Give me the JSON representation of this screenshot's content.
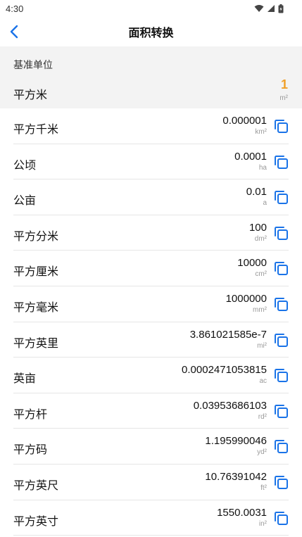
{
  "status_bar": {
    "time": "4:30"
  },
  "header": {
    "title": "面积转换"
  },
  "base": {
    "heading": "基准单位",
    "name": "平方米",
    "value": "1",
    "unit": "m²"
  },
  "units": [
    {
      "name": "平方千米",
      "value": "0.000001",
      "unit": "km²"
    },
    {
      "name": "公顷",
      "value": "0.0001",
      "unit": "ha"
    },
    {
      "name": "公亩",
      "value": "0.01",
      "unit": "a"
    },
    {
      "name": "平方分米",
      "value": "100",
      "unit": "dm²"
    },
    {
      "name": "平方厘米",
      "value": "10000",
      "unit": "cm²"
    },
    {
      "name": "平方毫米",
      "value": "1000000",
      "unit": "mm²"
    },
    {
      "name": "平方英里",
      "value": "3.861021585e-7",
      "unit": "mi²"
    },
    {
      "name": "英亩",
      "value": "0.0002471053815",
      "unit": "ac"
    },
    {
      "name": "平方杆",
      "value": "0.03953686103",
      "unit": "rd²"
    },
    {
      "name": "平方码",
      "value": "1.195990046",
      "unit": "yd²"
    },
    {
      "name": "平方英尺",
      "value": "10.76391042",
      "unit": "ft²"
    },
    {
      "name": "平方英寸",
      "value": "1550.0031",
      "unit": "in²"
    }
  ],
  "colors": {
    "accent": "#1a73e8",
    "base_value": "#f0a02a",
    "base_background": "#f3f3f3"
  },
  "icons": {
    "back": "chevron-left-icon",
    "copy": "copy-icon"
  }
}
